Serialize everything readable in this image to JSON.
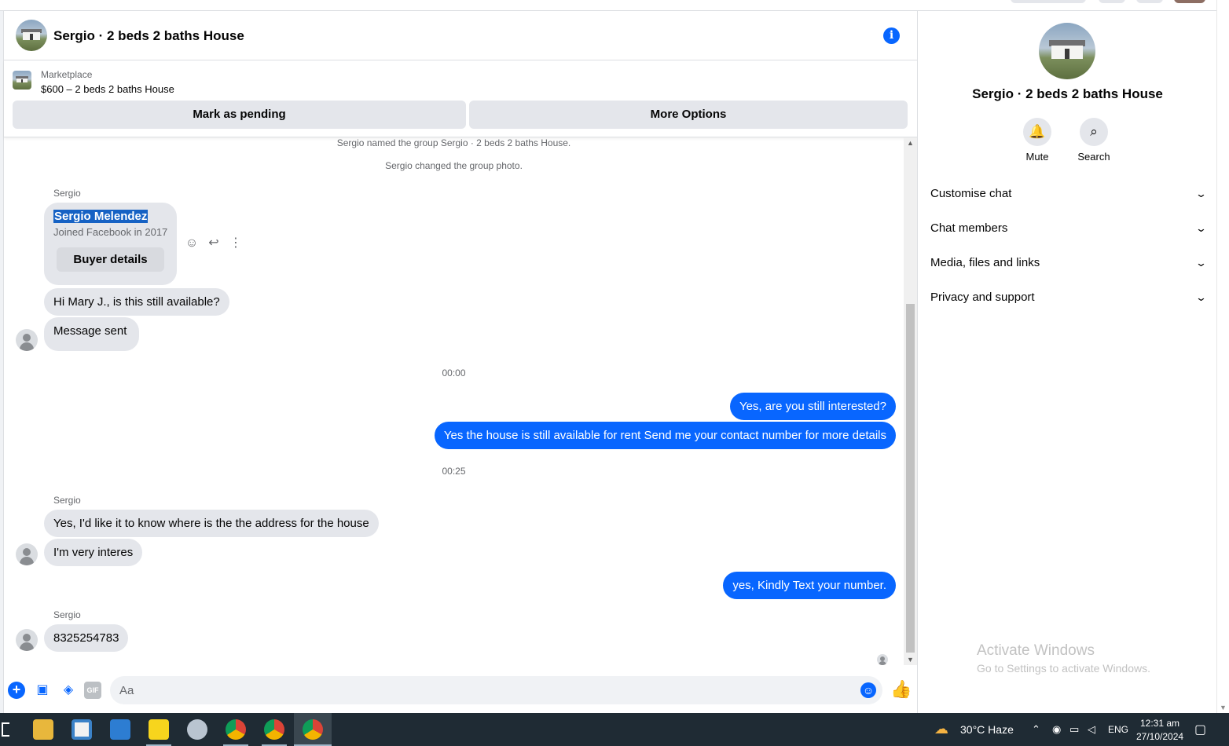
{
  "header": {
    "title": "Sergio · 2 beds 2 baths House",
    "info_icon": "info-icon"
  },
  "marketplace": {
    "label": "Marketplace",
    "listing": "$600 – 2 beds 2 baths House",
    "mark_pending_label": "Mark as pending",
    "more_options_label": "More Options"
  },
  "messages": {
    "system": [
      "Sergio named the group Sergio · 2 beds 2 baths House.",
      "Sergio changed the group photo."
    ],
    "sender_name": "Sergio",
    "buyer_card": {
      "name": "Sergio Melendez",
      "joined": "Joined Facebook in 2017",
      "button": "Buyer details"
    },
    "incoming_1": "Hi Mary J., is this still available?",
    "incoming_2": "Message sent",
    "time_1": "00:00",
    "outgoing_1": "Yes, are you still interested?",
    "outgoing_2": "Yes the house is still available for rent Send me your contact number for more details",
    "time_2": "00:25",
    "incoming_3": "Yes, I'd like it to know where is the the address for the house",
    "incoming_4": "I'm very interes",
    "outgoing_3": "yes, Kindly Text your number.",
    "incoming_5": "8325254783"
  },
  "composer": {
    "placeholder": "Aa"
  },
  "right_panel": {
    "title": "Sergio · 2 beds 2 baths House",
    "mute_label": "Mute",
    "search_label": "Search",
    "sections": [
      "Customise chat",
      "Chat members",
      "Media, files and links",
      "Privacy and support"
    ]
  },
  "watermark": {
    "title": "Activate Windows",
    "subtitle": "Go to Settings to activate Windows."
  },
  "taskbar": {
    "weather": "30°C  Haze",
    "language": "ENG",
    "time": "12:31 am",
    "date": "27/10/2024"
  },
  "colors": {
    "accent": "#0866ff",
    "incoming_bubble": "#e4e6eb",
    "taskbar": "#1f2b34"
  }
}
